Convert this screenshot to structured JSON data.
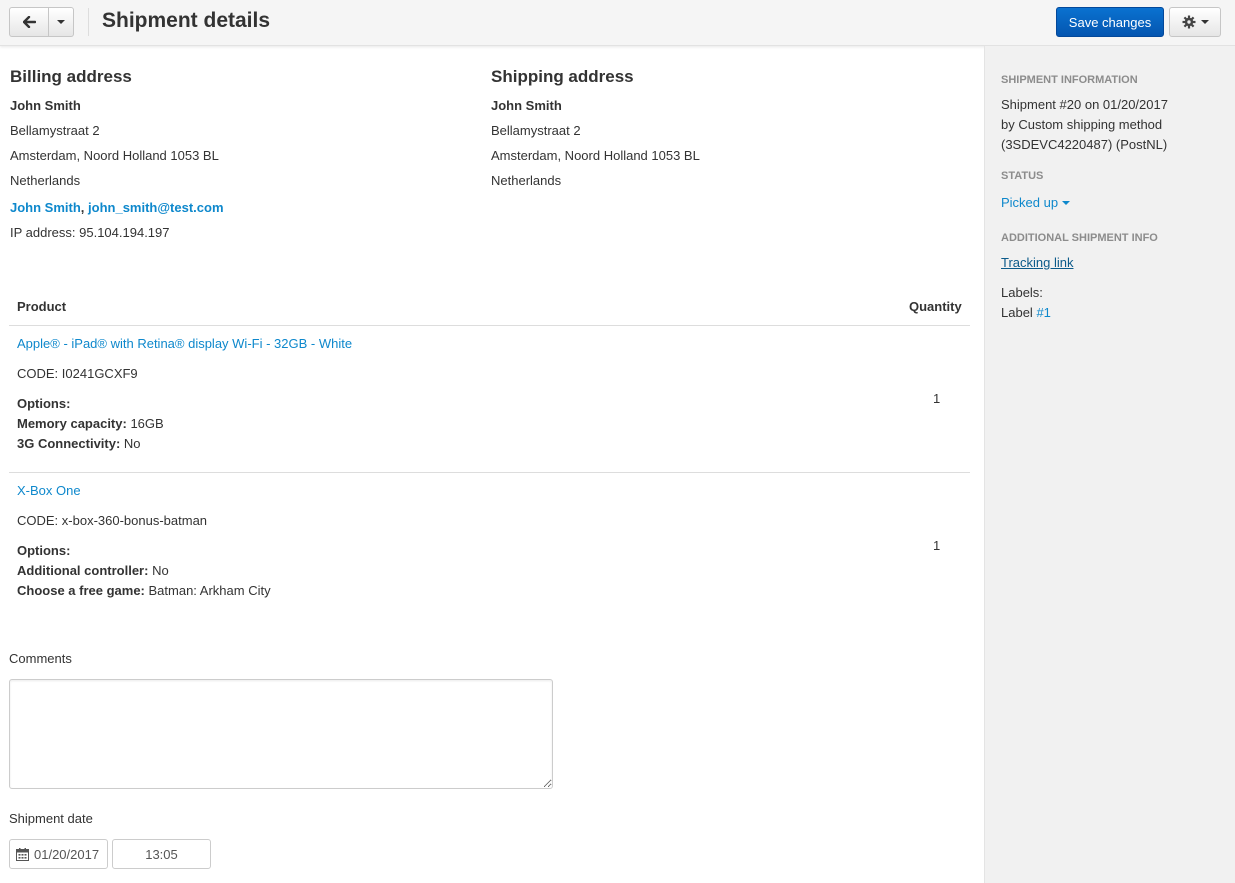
{
  "header": {
    "title": "Shipment details",
    "save_label": "Save changes"
  },
  "billing": {
    "title": "Billing address",
    "name": "John Smith",
    "street": "Bellamystraat 2",
    "city_line": "Amsterdam, Noord Holland 1053 BL",
    "country": "Netherlands",
    "contact_name": "John Smith",
    "contact_sep": ",",
    "email": "john_smith@test.com",
    "ip": "IP address: 95.104.194.197"
  },
  "shipping": {
    "title": "Shipping address",
    "name": "John Smith",
    "street": "Bellamystraat 2",
    "city_line": "Amsterdam, Noord Holland 1053 BL",
    "country": "Netherlands"
  },
  "table": {
    "col_product": "Product",
    "col_quantity": "Quantity",
    "rows": [
      {
        "name": "Apple® - iPad® with Retina® display Wi-Fi - 32GB - White",
        "code": "CODE: I0241GCXF9",
        "options_label": "Options:",
        "options": [
          {
            "name": "Memory capacity:",
            "value": "16GB"
          },
          {
            "name": "3G Connectivity:",
            "value": "No"
          }
        ],
        "quantity": "1"
      },
      {
        "name": "X-Box One",
        "code": "CODE: x-box-360-bonus-batman",
        "options_label": "Options:",
        "options": [
          {
            "name": "Additional controller:",
            "value": "No"
          },
          {
            "name": "Choose a free game:",
            "value": "Batman: Arkham City"
          }
        ],
        "quantity": "1"
      }
    ]
  },
  "form": {
    "comments_label": "Comments",
    "comments_value": "",
    "date_label": "Shipment date",
    "date_value": "01/20/2017",
    "time_value": "13:05"
  },
  "sidebar": {
    "info_head": "Shipment information",
    "info_line1": "Shipment #20 on 01/20/2017",
    "info_line2": "by Custom shipping method",
    "info_line3": "(3SDEVC4220487) (PostNL)",
    "status_head": "Status",
    "status_value": "Picked up",
    "additional_head": "Additional shipment info",
    "tracking_label": "Tracking link",
    "labels_label": "Labels:",
    "label_prefix": "Label",
    "label_link": "#1"
  },
  "icons": {
    "back": "arrow-left-icon",
    "dropdown": "chevron-down-icon",
    "settings": "gear-icon",
    "calendar": "calendar-icon"
  },
  "colors": {
    "primary": "#0a6cc9",
    "link": "#0e88cc",
    "sidebar_bg": "#f1f1f1"
  }
}
